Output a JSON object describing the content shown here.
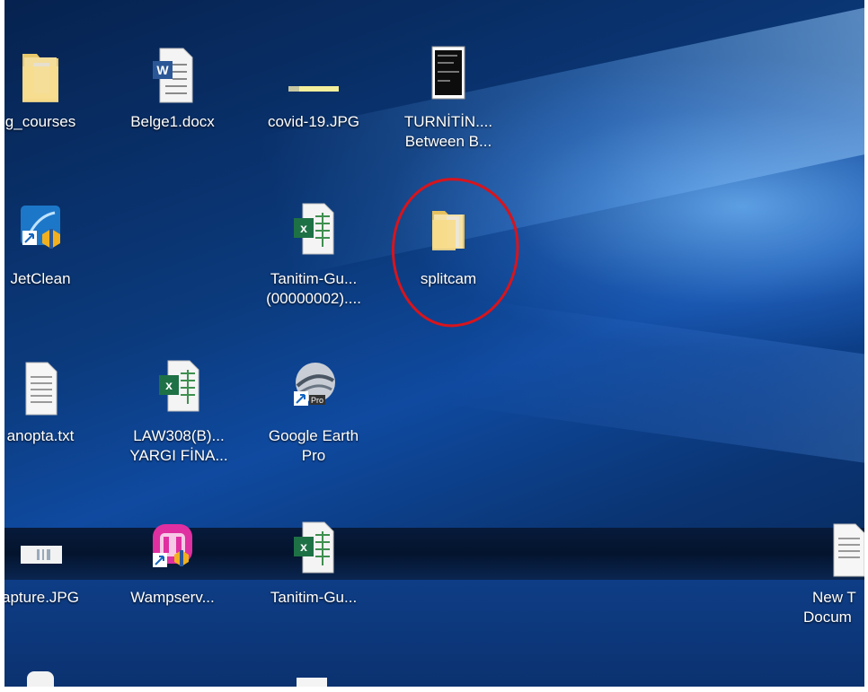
{
  "desktop": {
    "icons": [
      {
        "label": "g_courses",
        "icon": "folder-icon"
      },
      {
        "label": "Belge1.docx",
        "icon": "word-document-icon"
      },
      {
        "label": "covid-19.JPG",
        "icon": "image-file-icon"
      },
      {
        "label": "TURNİTİN....",
        "label2": "Between B...",
        "icon": "pdf-thumbnail-icon"
      },
      {
        "label": "JetClean",
        "icon": "jetclean-shortcut-icon"
      },
      {
        "label": "Tanitim-Gu...",
        "label2": "(00000002)....",
        "icon": "excel-file-icon"
      },
      {
        "label": "splitcam",
        "icon": "folder-icon"
      },
      {
        "label": "anopta.txt",
        "icon": "text-file-icon"
      },
      {
        "label": "LAW308(B)...",
        "label2": "YARGI FİNA...",
        "icon": "excel-file-icon"
      },
      {
        "label": "Google Earth",
        "label2": "Pro",
        "icon": "google-earth-shortcut-icon"
      },
      {
        "label": "apture.JPG",
        "icon": "image-file-icon"
      },
      {
        "label": "Wampserv...",
        "icon": "wampserver-shortcut-icon"
      },
      {
        "label": "Tanitim-Gu...",
        "icon": "excel-file-icon"
      },
      {
        "label": "New T",
        "label2": "Docum",
        "icon": "text-file-icon"
      }
    ],
    "annotation_color": "#d8141c"
  }
}
